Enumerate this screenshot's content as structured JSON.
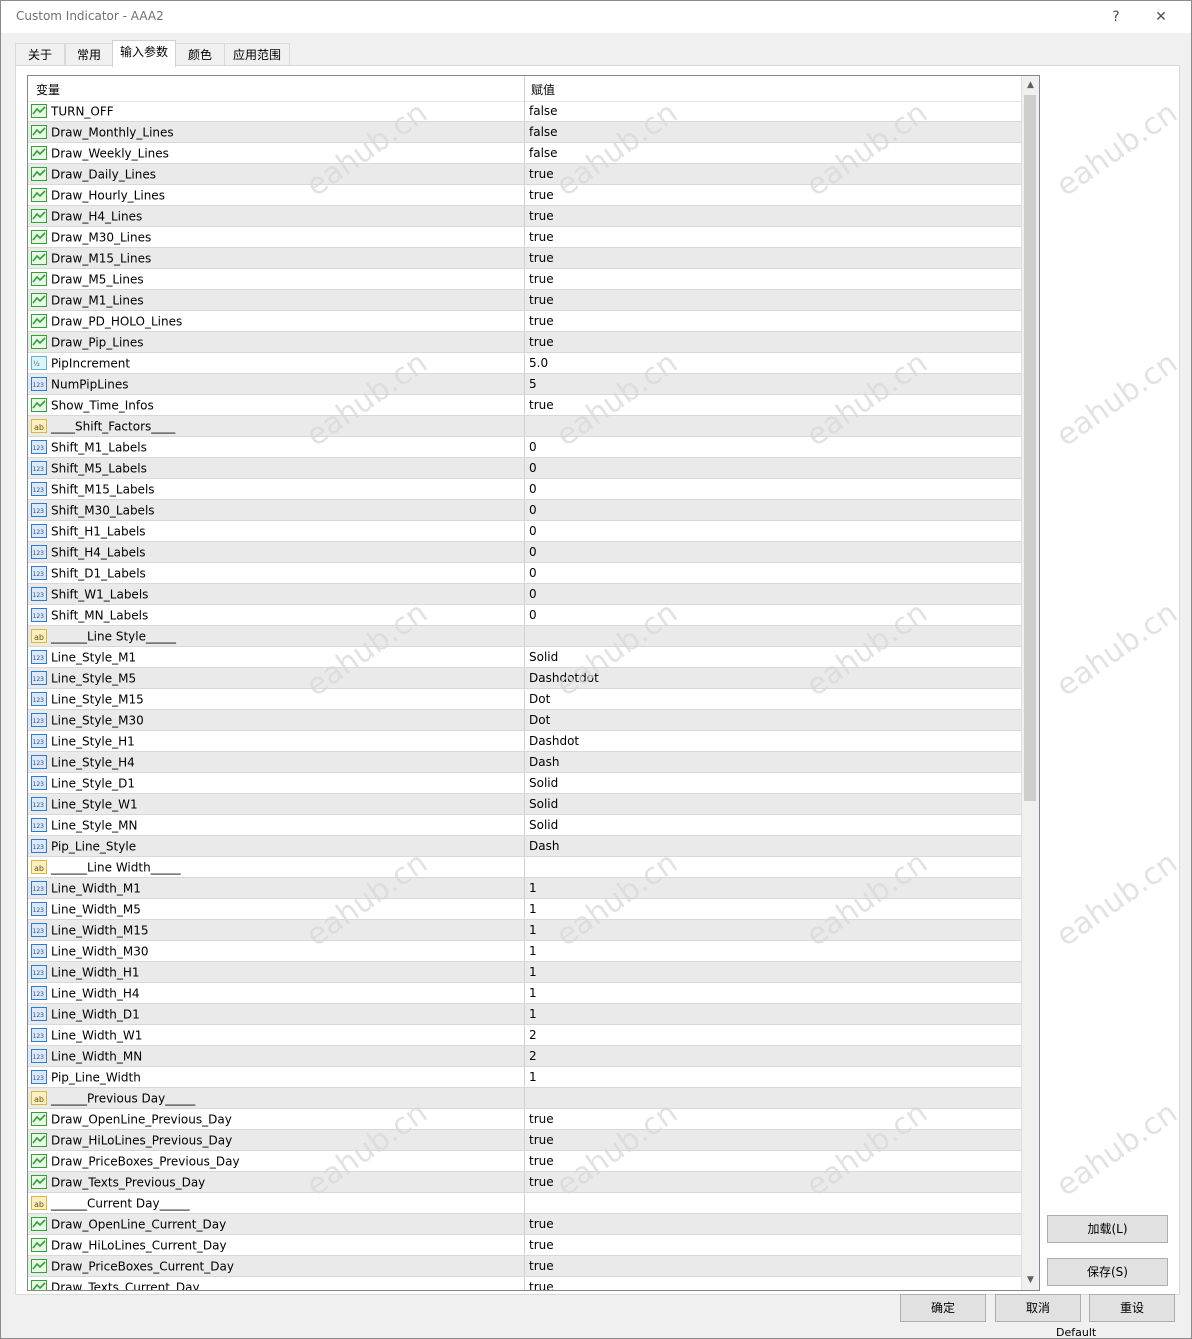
{
  "window": {
    "title": "Custom Indicator - AAA2",
    "help": "?",
    "close": "✕"
  },
  "tabs": [
    {
      "label": "关于"
    },
    {
      "label": "常用"
    },
    {
      "label": "输入参数"
    },
    {
      "label": "颜色"
    },
    {
      "label": "应用范围"
    }
  ],
  "table": {
    "headers": {
      "variable": "变量",
      "value": "赋值"
    },
    "rows": [
      {
        "icon": "bool",
        "name": "TURN_OFF",
        "value": "false"
      },
      {
        "icon": "bool",
        "name": "Draw_Monthly_Lines",
        "value": "false"
      },
      {
        "icon": "bool",
        "name": "Draw_Weekly_Lines",
        "value": "false"
      },
      {
        "icon": "bool",
        "name": "Draw_Daily_Lines",
        "value": "true"
      },
      {
        "icon": "bool",
        "name": "Draw_Hourly_Lines",
        "value": "true"
      },
      {
        "icon": "bool",
        "name": "Draw_H4_Lines",
        "value": "true"
      },
      {
        "icon": "bool",
        "name": "Draw_M30_Lines",
        "value": "true"
      },
      {
        "icon": "bool",
        "name": "Draw_M15_Lines",
        "value": "true"
      },
      {
        "icon": "bool",
        "name": "Draw_M5_Lines",
        "value": "true"
      },
      {
        "icon": "bool",
        "name": "Draw_M1_Lines",
        "value": "true"
      },
      {
        "icon": "bool",
        "name": "Draw_PD_HOLO_Lines",
        "value": "true"
      },
      {
        "icon": "bool",
        "name": "Draw_Pip_Lines",
        "value": "true"
      },
      {
        "icon": "double",
        "name": "PipIncrement",
        "value": "5.0"
      },
      {
        "icon": "int",
        "name": "NumPipLines",
        "value": "5"
      },
      {
        "icon": "bool",
        "name": "Show_Time_Infos",
        "value": "true"
      },
      {
        "icon": "string",
        "name": "____Shift_Factors____",
        "value": ""
      },
      {
        "icon": "int",
        "name": "Shift_M1_Labels",
        "value": "0"
      },
      {
        "icon": "int",
        "name": "Shift_M5_Labels",
        "value": "0"
      },
      {
        "icon": "int",
        "name": "Shift_M15_Labels",
        "value": "0"
      },
      {
        "icon": "int",
        "name": "Shift_M30_Labels",
        "value": "0"
      },
      {
        "icon": "int",
        "name": "Shift_H1_Labels",
        "value": "0"
      },
      {
        "icon": "int",
        "name": "Shift_H4_Labels",
        "value": "0"
      },
      {
        "icon": "int",
        "name": "Shift_D1_Labels",
        "value": "0"
      },
      {
        "icon": "int",
        "name": "Shift_W1_Labels",
        "value": "0"
      },
      {
        "icon": "int",
        "name": "Shift_MN_Labels",
        "value": "0"
      },
      {
        "icon": "string",
        "name": "______Line Style_____",
        "value": ""
      },
      {
        "icon": "int",
        "name": "Line_Style_M1",
        "value": "Solid"
      },
      {
        "icon": "int",
        "name": "Line_Style_M5",
        "value": "Dashdotdot"
      },
      {
        "icon": "int",
        "name": "Line_Style_M15",
        "value": "Dot"
      },
      {
        "icon": "int",
        "name": "Line_Style_M30",
        "value": "Dot"
      },
      {
        "icon": "int",
        "name": "Line_Style_H1",
        "value": "Dashdot"
      },
      {
        "icon": "int",
        "name": "Line_Style_H4",
        "value": "Dash"
      },
      {
        "icon": "int",
        "name": "Line_Style_D1",
        "value": "Solid"
      },
      {
        "icon": "int",
        "name": "Line_Style_W1",
        "value": "Solid"
      },
      {
        "icon": "int",
        "name": "Line_Style_MN",
        "value": "Solid"
      },
      {
        "icon": "int",
        "name": "Pip_Line_Style",
        "value": "Dash"
      },
      {
        "icon": "string",
        "name": "______Line Width_____",
        "value": ""
      },
      {
        "icon": "int",
        "name": "Line_Width_M1",
        "value": "1"
      },
      {
        "icon": "int",
        "name": "Line_Width_M5",
        "value": "1"
      },
      {
        "icon": "int",
        "name": "Line_Width_M15",
        "value": "1"
      },
      {
        "icon": "int",
        "name": "Line_Width_M30",
        "value": "1"
      },
      {
        "icon": "int",
        "name": "Line_Width_H1",
        "value": "1"
      },
      {
        "icon": "int",
        "name": "Line_Width_H4",
        "value": "1"
      },
      {
        "icon": "int",
        "name": "Line_Width_D1",
        "value": "1"
      },
      {
        "icon": "int",
        "name": "Line_Width_W1",
        "value": "2"
      },
      {
        "icon": "int",
        "name": "Line_Width_MN",
        "value": "2"
      },
      {
        "icon": "int",
        "name": "Pip_Line_Width",
        "value": "1"
      },
      {
        "icon": "string",
        "name": "______Previous Day_____",
        "value": ""
      },
      {
        "icon": "bool",
        "name": "Draw_OpenLine_Previous_Day",
        "value": "true"
      },
      {
        "icon": "bool",
        "name": "Draw_HiLoLines_Previous_Day",
        "value": "true"
      },
      {
        "icon": "bool",
        "name": "Draw_PriceBoxes_Previous_Day",
        "value": "true"
      },
      {
        "icon": "bool",
        "name": "Draw_Texts_Previous_Day",
        "value": "true"
      },
      {
        "icon": "string",
        "name": "______Current Day_____",
        "value": ""
      },
      {
        "icon": "bool",
        "name": "Draw_OpenLine_Current_Day",
        "value": "true"
      },
      {
        "icon": "bool",
        "name": "Draw_HiLoLines_Current_Day",
        "value": "true"
      },
      {
        "icon": "bool",
        "name": "Draw_PriceBoxes_Current_Day",
        "value": "true"
      },
      {
        "icon": "bool",
        "name": "Draw_Texts_Current_Day",
        "value": "true"
      }
    ]
  },
  "side_buttons": {
    "load": "加载(L)",
    "save": "保存(S)"
  },
  "footer_buttons": {
    "ok": "确定",
    "cancel": "取消",
    "reset": "重设"
  },
  "watermark": "eahub.cn",
  "background_label": "Default",
  "colors": {
    "bool_icon": "#2fa52f",
    "int_icon": "#2b7bd1",
    "double_icon": "#58b7d9",
    "string_icon": "#d9b93a",
    "row_alt": "#eaeaea"
  }
}
